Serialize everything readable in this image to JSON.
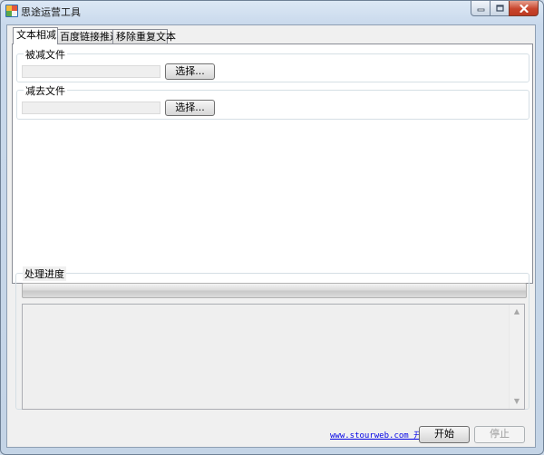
{
  "window": {
    "title": "思途运营工具",
    "icon": "app-icon",
    "controls": {
      "minimize": "minimize-icon",
      "maximize": "maximize-icon",
      "close": "close-icon"
    }
  },
  "tabs": [
    {
      "label": "文本相减",
      "active": true
    },
    {
      "label": "百度链接推送",
      "active": false
    },
    {
      "label": "移除重复文本",
      "active": false
    }
  ],
  "subtract": {
    "source_group": {
      "label": "被减文件",
      "path_value": "",
      "choose_label": "选择..."
    },
    "remove_group": {
      "label": "减去文件",
      "path_value": "",
      "choose_label": "选择..."
    }
  },
  "progress": {
    "label": "处理进度",
    "value": 0
  },
  "log": {
    "text": ""
  },
  "footer": {
    "link": "www.stourweb.com 开发",
    "start_label": "开始",
    "stop_label": "停止"
  },
  "colors": {
    "link": "#0000e6",
    "progress_fill": "#3fae31",
    "close_button": "#c8452c"
  }
}
